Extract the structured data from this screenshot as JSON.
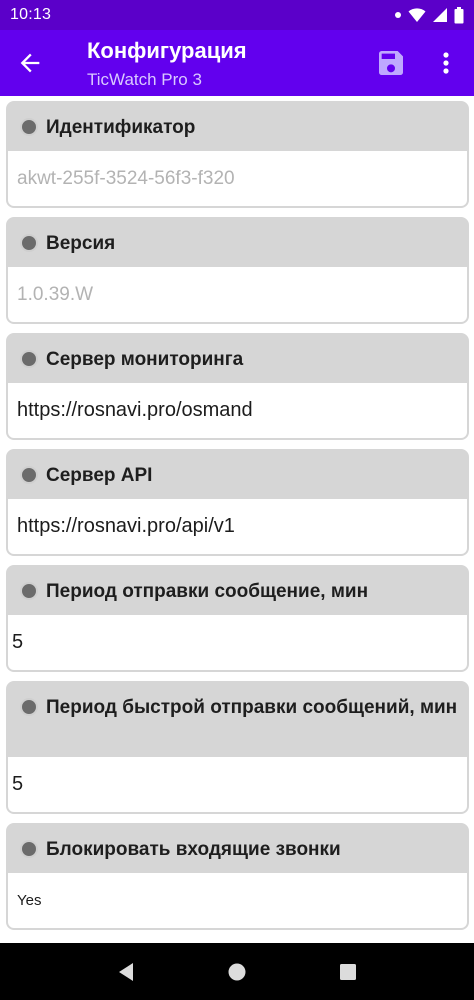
{
  "status_bar": {
    "time": "10:13"
  },
  "app_bar": {
    "title": "Конфигурация",
    "subtitle": "TicWatch Pro 3"
  },
  "settings": [
    {
      "label": "Идентификатор",
      "value": "akwt-255f-3524-56f3-f320"
    },
    {
      "label": "Версия",
      "value": "1.0.39.W"
    },
    {
      "label": "Сервер мониторинга",
      "value": "https://rosnavi.pro/osmand"
    },
    {
      "label": "Сервер API",
      "value": "https://rosnavi.pro/api/v1"
    },
    {
      "label": "Период отправки сообщение, мин",
      "value": "5"
    },
    {
      "label": "Период быстрой отправки сообщений, мин",
      "value": "5"
    },
    {
      "label": "Блокировать входящие звонки",
      "value": "Yes"
    }
  ],
  "colors": {
    "primary": "#6200ee",
    "status": "#5b00c9",
    "card": "#d6d6d6"
  }
}
